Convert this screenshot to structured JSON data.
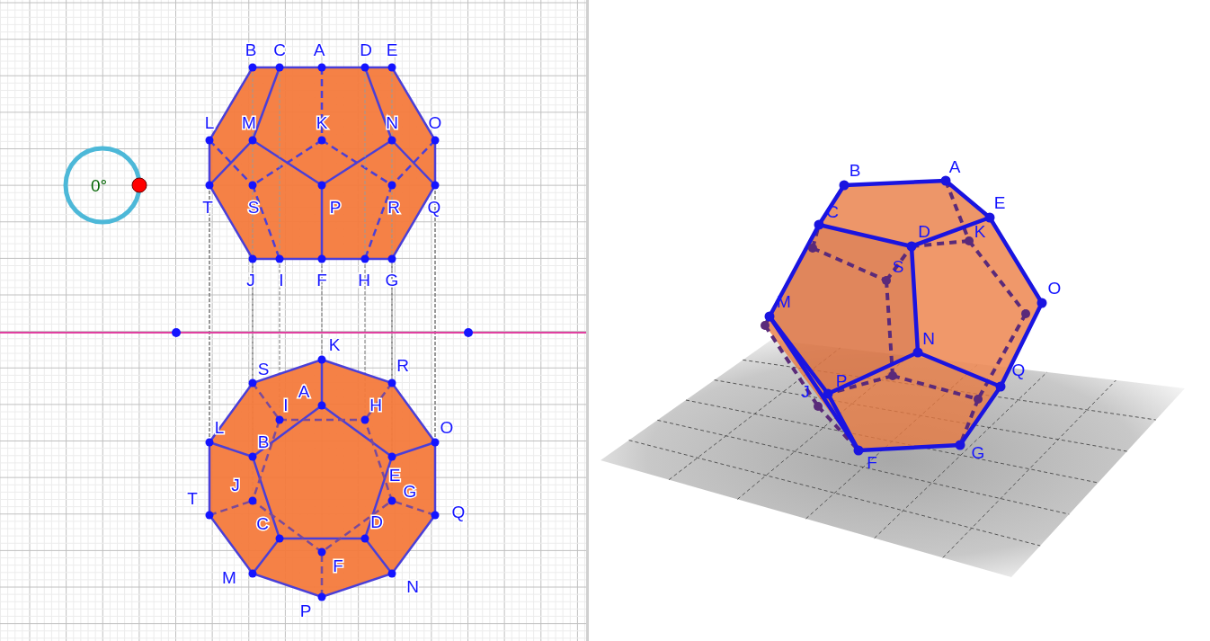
{
  "graphics_2d": {
    "angle_slider": {
      "value": "0°"
    },
    "front_view": {
      "labels": [
        "B",
        "C",
        "A",
        "D",
        "E",
        "L",
        "M",
        "K",
        "N",
        "O",
        "T",
        "S",
        "P",
        "R",
        "Q",
        "J",
        "I",
        "F",
        "H",
        "G"
      ]
    },
    "top_view": {
      "labels": [
        "K",
        "S",
        "R",
        "A",
        "I",
        "H",
        "O",
        "L",
        "B",
        "J",
        "E",
        "G",
        "T",
        "Q",
        "C",
        "D",
        "F",
        "M",
        "N",
        "P"
      ]
    }
  },
  "graphics_3d": {
    "labels": [
      "B",
      "A",
      "E",
      "C",
      "D",
      "K",
      "S",
      "O",
      "M",
      "N",
      "Q",
      "P",
      "J",
      "F",
      "G"
    ]
  }
}
